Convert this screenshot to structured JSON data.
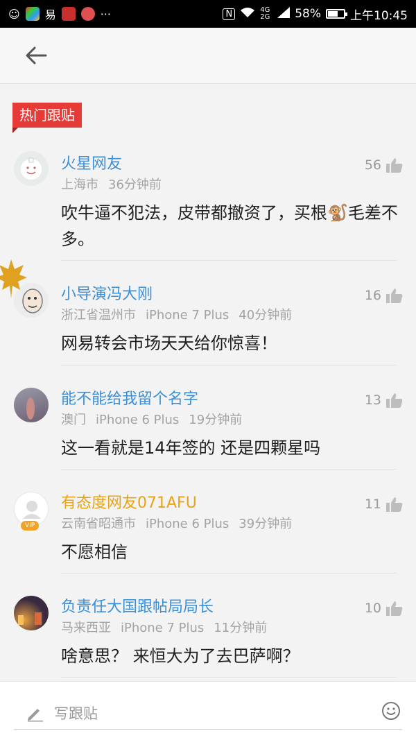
{
  "status_bar": {
    "battery_percent": "58%",
    "time": "上午10:45",
    "network": "4G 2G"
  },
  "section_tag": "热门跟贴",
  "comments": [
    {
      "username": "火星网友",
      "location": "上海市",
      "device": "",
      "time": "36分钟前",
      "likes": "56",
      "text": "吹牛逼不犯法，皮带都撤资了，买根🐒毛差不多。",
      "vip": false
    },
    {
      "username": "小导演冯大刚",
      "location": "浙江省温州市",
      "device": "iPhone 7 Plus",
      "time": "40分钟前",
      "likes": "16",
      "text": "网易转会市场天天给你惊喜！",
      "vip": false
    },
    {
      "username": "能不能给我留个名字",
      "location": "澳门",
      "device": "iPhone 6 Plus",
      "time": "19分钟前",
      "likes": "13",
      "text": "这一看就是14年签的 还是四颗星吗",
      "vip": false
    },
    {
      "username": "有态度网友071AFU",
      "location": "云南省昭通市",
      "device": "iPhone 6 Plus",
      "time": "39分钟前",
      "likes": "11",
      "text": "不愿相信",
      "vip": true,
      "badge": "VIP"
    },
    {
      "username": "负责任大国跟帖局局长",
      "location": "马来西亚",
      "device": "iPhone 7 Plus",
      "time": "11分钟前",
      "likes": "10",
      "text": "啥意思？ 来恒大为了去巴萨啊？",
      "vip": false
    }
  ],
  "compose": {
    "placeholder": "写跟贴"
  },
  "colors": {
    "accent_tag": "#e53a36",
    "username": "#3a8fd9",
    "vip_username": "#e8a317"
  }
}
